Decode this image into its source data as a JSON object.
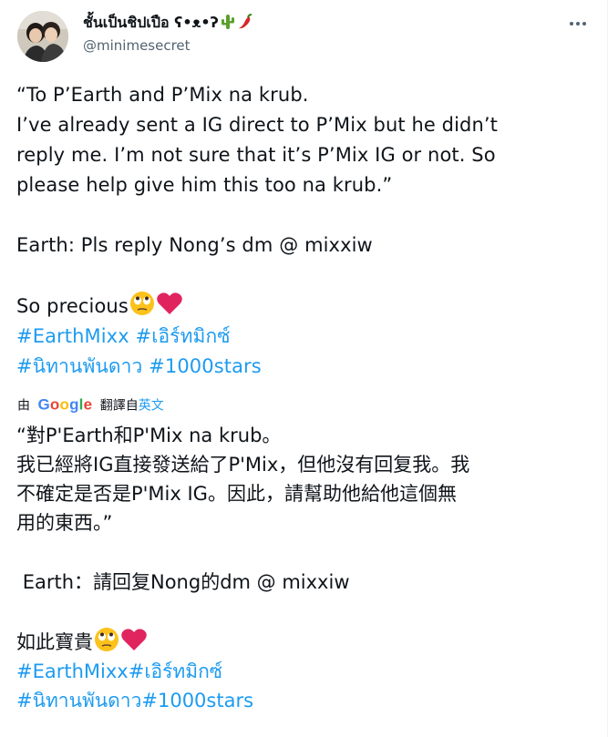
{
  "author": {
    "display_name": "ชั้นเป็นชิปเปือ ʕ•ᴥ•ʔ",
    "display_emoji": [
      "cactus-icon",
      "chili-pepper-icon"
    ],
    "handle": "@minimesecret"
  },
  "more_button": {
    "icon": "more-dots-icon"
  },
  "tweet": {
    "lines": {
      "l1": "“To P’Earth and P’Mix na krub.",
      "l2": "I’ve already sent a IG direct to P’Mix but he didn’t",
      "l3": "reply me. I’m not sure that it’s P’Mix IG or not. So",
      "l4": "please help give him this too na krub.”",
      "l5": "Earth: Pls reply Nong’s dm @ mixxiw",
      "l6": "So precious"
    },
    "hashtags": {
      "h1": "#EarthMixx",
      "h2": "#เอิร์ทมิกซ์",
      "h3": "#นิทานพันดาว",
      "h4": "#1000stars"
    },
    "emoji": [
      "face-with-rolling-eyes-icon",
      "red-heart-icon"
    ]
  },
  "translation": {
    "by_label": "由",
    "provider": "Google",
    "translated_from": "翻譯自",
    "source_language": "英文",
    "lines": {
      "t1": "“對P'Earth和P'Mix na krub。",
      "t2": "我已經將IG直接發送給了P'Mix，但他沒有回复我。我",
      "t3": "不確定是否是P'Mix IG。因此，請幫助他給他這個無",
      "t4": "用的東西。”",
      "t5": " Earth：請回复Nong的dm @ mixxiw",
      "t6": "如此寶貴"
    },
    "hashtags": {
      "h1": "#EarthMixx",
      "h2": "#เอิร์ทมิกซ์",
      "h3": "#นิทานพันดาว",
      "h4": "#1000stars"
    }
  },
  "colors": {
    "text": "#0f1419",
    "secondary": "#536471",
    "link": "#1d9bf0",
    "heart": "#e0245e"
  }
}
